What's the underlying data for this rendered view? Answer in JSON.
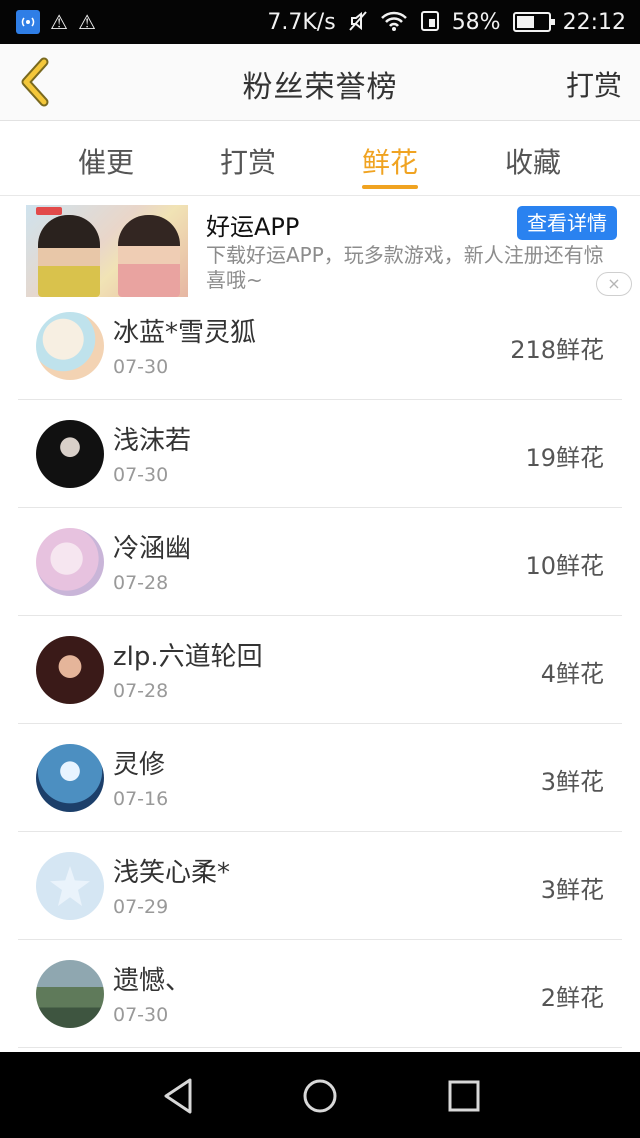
{
  "status_bar": {
    "network_speed": "7.7K/s",
    "battery_percent": "58%",
    "battery_level": 0.58,
    "time": "22:12",
    "icons": [
      "signal-icon",
      "warning-icon",
      "warning-icon",
      "mute-icon",
      "wifi-icon",
      "sim-icon",
      "battery-icon"
    ]
  },
  "header": {
    "title": "粉丝荣誉榜",
    "action_label": "打赏"
  },
  "tabs": [
    {
      "label": "催更",
      "active": false
    },
    {
      "label": "打赏",
      "active": false
    },
    {
      "label": "鲜花",
      "active": true
    },
    {
      "label": "收藏",
      "active": false
    }
  ],
  "ad": {
    "title": "好运APP",
    "button_label": "查看详情",
    "description": "下载好运APP，玩多款游戏，新人注册还有惊喜哦~",
    "close_icon": "×"
  },
  "list": [
    {
      "name": "冰蓝*雪灵狐",
      "date": "07-30",
      "count": "218鲜花"
    },
    {
      "name": "浅沫若",
      "date": "07-30",
      "count": "19鲜花"
    },
    {
      "name": "冷涵幽",
      "date": "07-28",
      "count": "10鲜花"
    },
    {
      "name": "zlp.六道轮回",
      "date": "07-28",
      "count": "4鲜花"
    },
    {
      "name": "灵修",
      "date": "07-16",
      "count": "3鲜花"
    },
    {
      "name": "浅笑心柔*",
      "date": "07-29",
      "count": "3鲜花"
    },
    {
      "name": "遗憾、",
      "date": "07-30",
      "count": "2鲜花"
    }
  ],
  "colors": {
    "accent": "#f0a321",
    "ad_button": "#2a82f0",
    "text_primary": "#333333",
    "text_secondary": "#999999"
  }
}
